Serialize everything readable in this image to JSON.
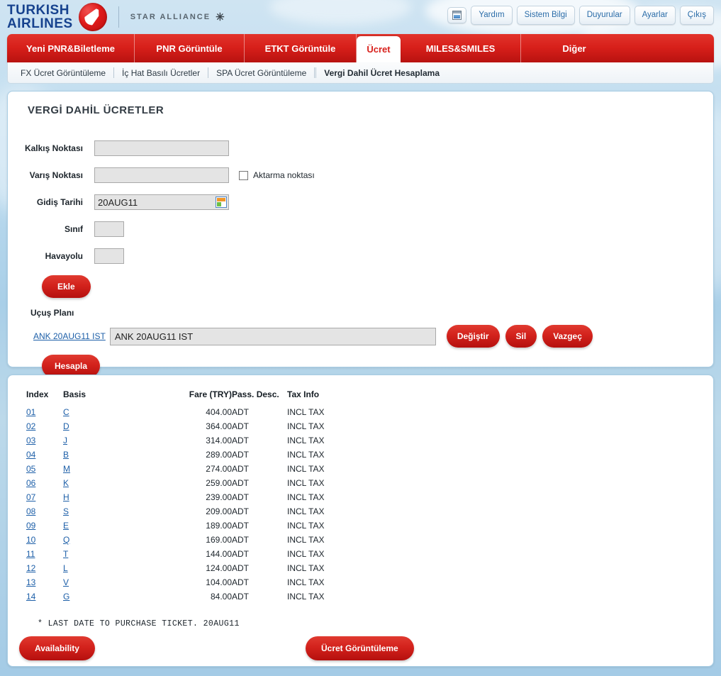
{
  "brand": {
    "line1": "TURKISH",
    "line2": "AIRLINES",
    "alliance": "STAR ALLIANCE",
    "alliance_mark": "✳"
  },
  "header": {
    "window_icon": "window-icon",
    "buttons": [
      "Yardım",
      "Sistem Bilgi",
      "Duyurular",
      "Ayarlar",
      "Çıkış"
    ]
  },
  "mainnav": {
    "items": [
      {
        "label": "Yeni PNR&Biletleme",
        "active": false
      },
      {
        "label": "PNR Görüntüle",
        "active": false
      },
      {
        "label": "ETKT Görüntüle",
        "active": false
      },
      {
        "label": "Ücret",
        "active": true
      },
      {
        "label": "MILES&SMILES",
        "active": false
      },
      {
        "label": "Diğer",
        "active": false
      }
    ]
  },
  "subnav": {
    "items": [
      {
        "label": "FX Ücret Görüntüleme",
        "active": false
      },
      {
        "label": "İç Hat Basılı Ücretler",
        "active": false
      },
      {
        "label": "SPA Ücret Görüntüleme",
        "active": false
      },
      {
        "label": "Vergi Dahil Ücret Hesaplama",
        "active": true
      }
    ]
  },
  "form": {
    "title": "VERGİ DAHİL ÜCRETLER",
    "fields": {
      "origin": {
        "label": "Kalkış Noktası",
        "value": ""
      },
      "destination": {
        "label": "Varış Noktası",
        "value": ""
      },
      "departure_date": {
        "label": "Gidiş Tarihi",
        "value": "20AUG11"
      },
      "class": {
        "label": "Sınıf",
        "value": ""
      },
      "airline": {
        "label": "Havayolu",
        "value": ""
      }
    },
    "transfer_checkbox": {
      "label": "Aktarma noktası",
      "checked": false
    },
    "add_button": "Ekle",
    "flight_plan_label": "Uçuş Planı",
    "flight_plan_link": "ANK 20AUG11 IST",
    "flight_plan_value": "ANK 20AUG11 IST",
    "plan_buttons": [
      "Değiştir",
      "Sil",
      "Vazgeç"
    ],
    "calculate_button": "Hesapla",
    "calendar_icon": "calendar-icon"
  },
  "results": {
    "columns": [
      "Index",
      "Basis",
      "Fare (TRY)",
      "Pass. Desc.",
      "Tax Info"
    ],
    "rows": [
      {
        "index": "01",
        "basis": "C",
        "fare": "404.00",
        "pass": "ADT",
        "tax": "INCL TAX"
      },
      {
        "index": "02",
        "basis": "D",
        "fare": "364.00",
        "pass": "ADT",
        "tax": "INCL TAX"
      },
      {
        "index": "03",
        "basis": "J",
        "fare": "314.00",
        "pass": "ADT",
        "tax": "INCL TAX"
      },
      {
        "index": "04",
        "basis": "B",
        "fare": "289.00",
        "pass": "ADT",
        "tax": "INCL TAX"
      },
      {
        "index": "05",
        "basis": "M",
        "fare": "274.00",
        "pass": "ADT",
        "tax": "INCL TAX"
      },
      {
        "index": "06",
        "basis": "K",
        "fare": "259.00",
        "pass": "ADT",
        "tax": "INCL TAX"
      },
      {
        "index": "07",
        "basis": "H",
        "fare": "239.00",
        "pass": "ADT",
        "tax": "INCL TAX"
      },
      {
        "index": "08",
        "basis": "S",
        "fare": "209.00",
        "pass": "ADT",
        "tax": "INCL TAX"
      },
      {
        "index": "09",
        "basis": "E",
        "fare": "189.00",
        "pass": "ADT",
        "tax": "INCL TAX"
      },
      {
        "index": "10",
        "basis": "Q",
        "fare": "169.00",
        "pass": "ADT",
        "tax": "INCL TAX"
      },
      {
        "index": "11",
        "basis": "T",
        "fare": "144.00",
        "pass": "ADT",
        "tax": "INCL TAX"
      },
      {
        "index": "12",
        "basis": "L",
        "fare": "124.00",
        "pass": "ADT",
        "tax": "INCL TAX"
      },
      {
        "index": "13",
        "basis": "V",
        "fare": "104.00",
        "pass": "ADT",
        "tax": "INCL TAX"
      },
      {
        "index": "14",
        "basis": "G",
        "fare": "84.00",
        "pass": "ADT",
        "tax": "INCL TAX"
      }
    ],
    "note": "*   LAST DATE TO PURCHASE TICKET. 20AUG11",
    "availability_button": "Availability",
    "fare_display_button": "Ücret Görüntüleme"
  },
  "colors": {
    "brand_red": "#d3221c",
    "brand_blue": "#16428e",
    "link_blue": "#1d5fa8",
    "input_gray": "#e4e4e4",
    "sky": "#bedcef"
  }
}
